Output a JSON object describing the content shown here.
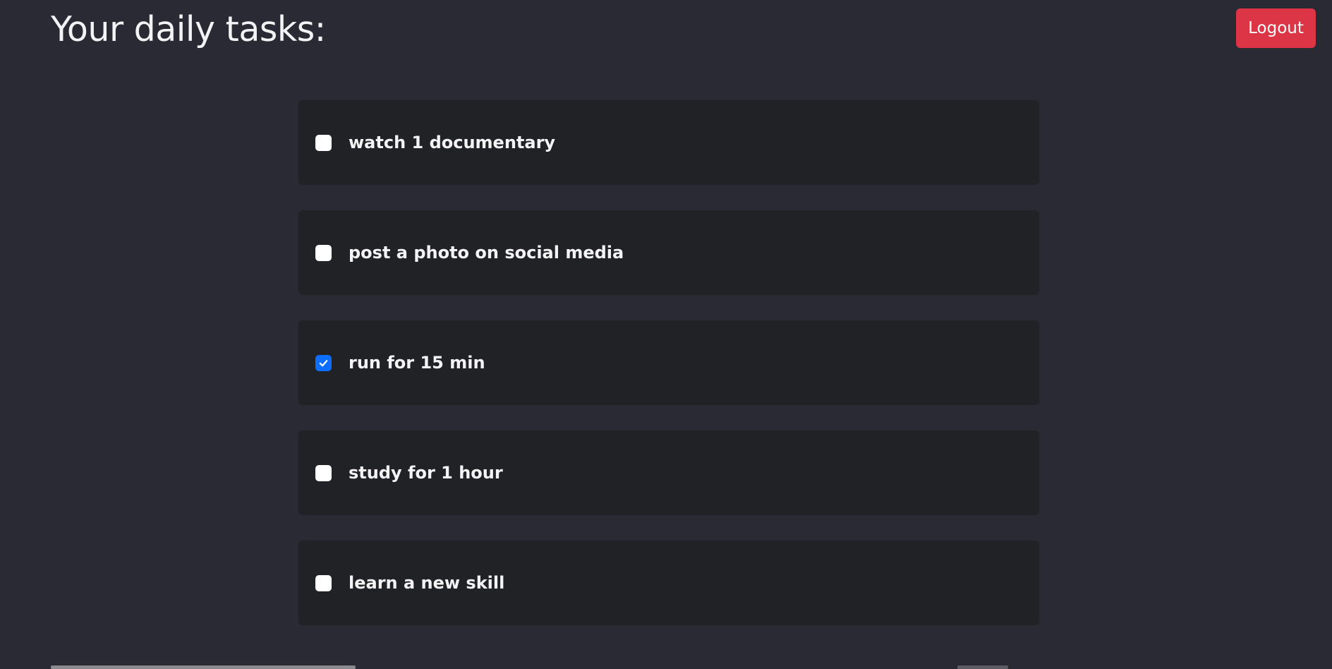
{
  "header": {
    "title": "Your daily tasks:",
    "logout_label": "Logout"
  },
  "tasks": [
    {
      "label": "watch 1 documentary",
      "checked": false
    },
    {
      "label": "post a photo on social media",
      "checked": false
    },
    {
      "label": "run for 15 min",
      "checked": true
    },
    {
      "label": "study for 1 hour",
      "checked": false
    },
    {
      "label": "learn a new skill",
      "checked": false
    }
  ],
  "colors": {
    "background": "#2a2a35",
    "card": "#212226",
    "logout": "#dc3545",
    "checkbox_checked": "#0d6efd"
  },
  "icons": {
    "checkbox": "checkbox-icon",
    "checkmark": "checkmark-icon"
  }
}
